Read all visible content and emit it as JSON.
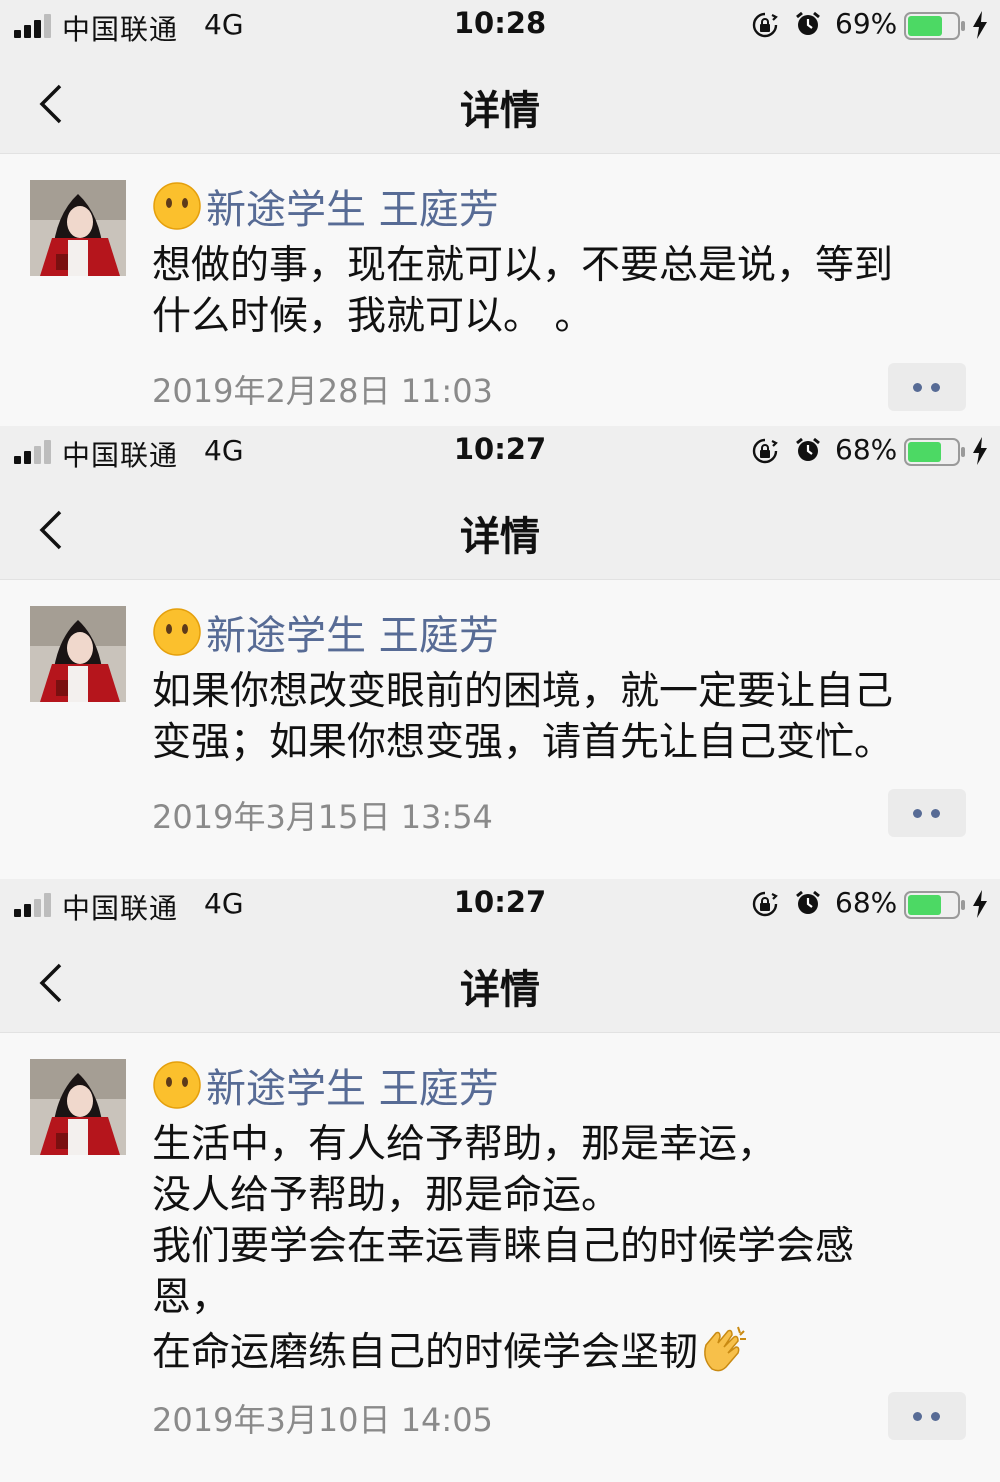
{
  "screens": [
    {
      "status": {
        "carrier": "中国联通",
        "network": "4G",
        "time": "10:28",
        "battery": "69%"
      },
      "nav": {
        "title": "详情"
      },
      "post": {
        "author": "新途学生 王庭芳",
        "content": "想做的事，现在就可以，不要总是说，等到\n什么时候，我就可以。 。",
        "timestamp": "2019年2月28日 11:03"
      }
    },
    {
      "status": {
        "carrier": "中国联通",
        "network": "4G",
        "time": "10:27",
        "battery": "68%"
      },
      "nav": {
        "title": "详情"
      },
      "post": {
        "author": "新途学生 王庭芳",
        "content": "如果你想改变眼前的困境，就一定要让自己\n变强；如果你想变强，请首先让自己变忙。",
        "timestamp": "2019年3月15日 13:54"
      }
    },
    {
      "status": {
        "carrier": "中国联通",
        "network": "4G",
        "time": "10:27",
        "battery": "68%"
      },
      "nav": {
        "title": "详情"
      },
      "post": {
        "author": "新途学生 王庭芳",
        "content": "生活中，有人给予帮助，那是幸运，\n没人给予帮助，那是命运。\n我们要学会在幸运青睐自己的时候学会感\n恩，\n在命运磨练自己的时候学会坚韧",
        "timestamp": "2019年3月10日 14:05"
      }
    }
  ],
  "icons": {
    "back": "chevron-left-icon",
    "more": "more-dots-icon",
    "face": "neutral-face-emoji-icon",
    "clap": "clapping-hands-emoji-icon"
  },
  "colors": {
    "name_link": "#576b95",
    "bar_background": "#efefef",
    "page_background": "#f8f8f8",
    "battery_fill": "#4cd964",
    "timestamp": "#8a8a8a"
  }
}
